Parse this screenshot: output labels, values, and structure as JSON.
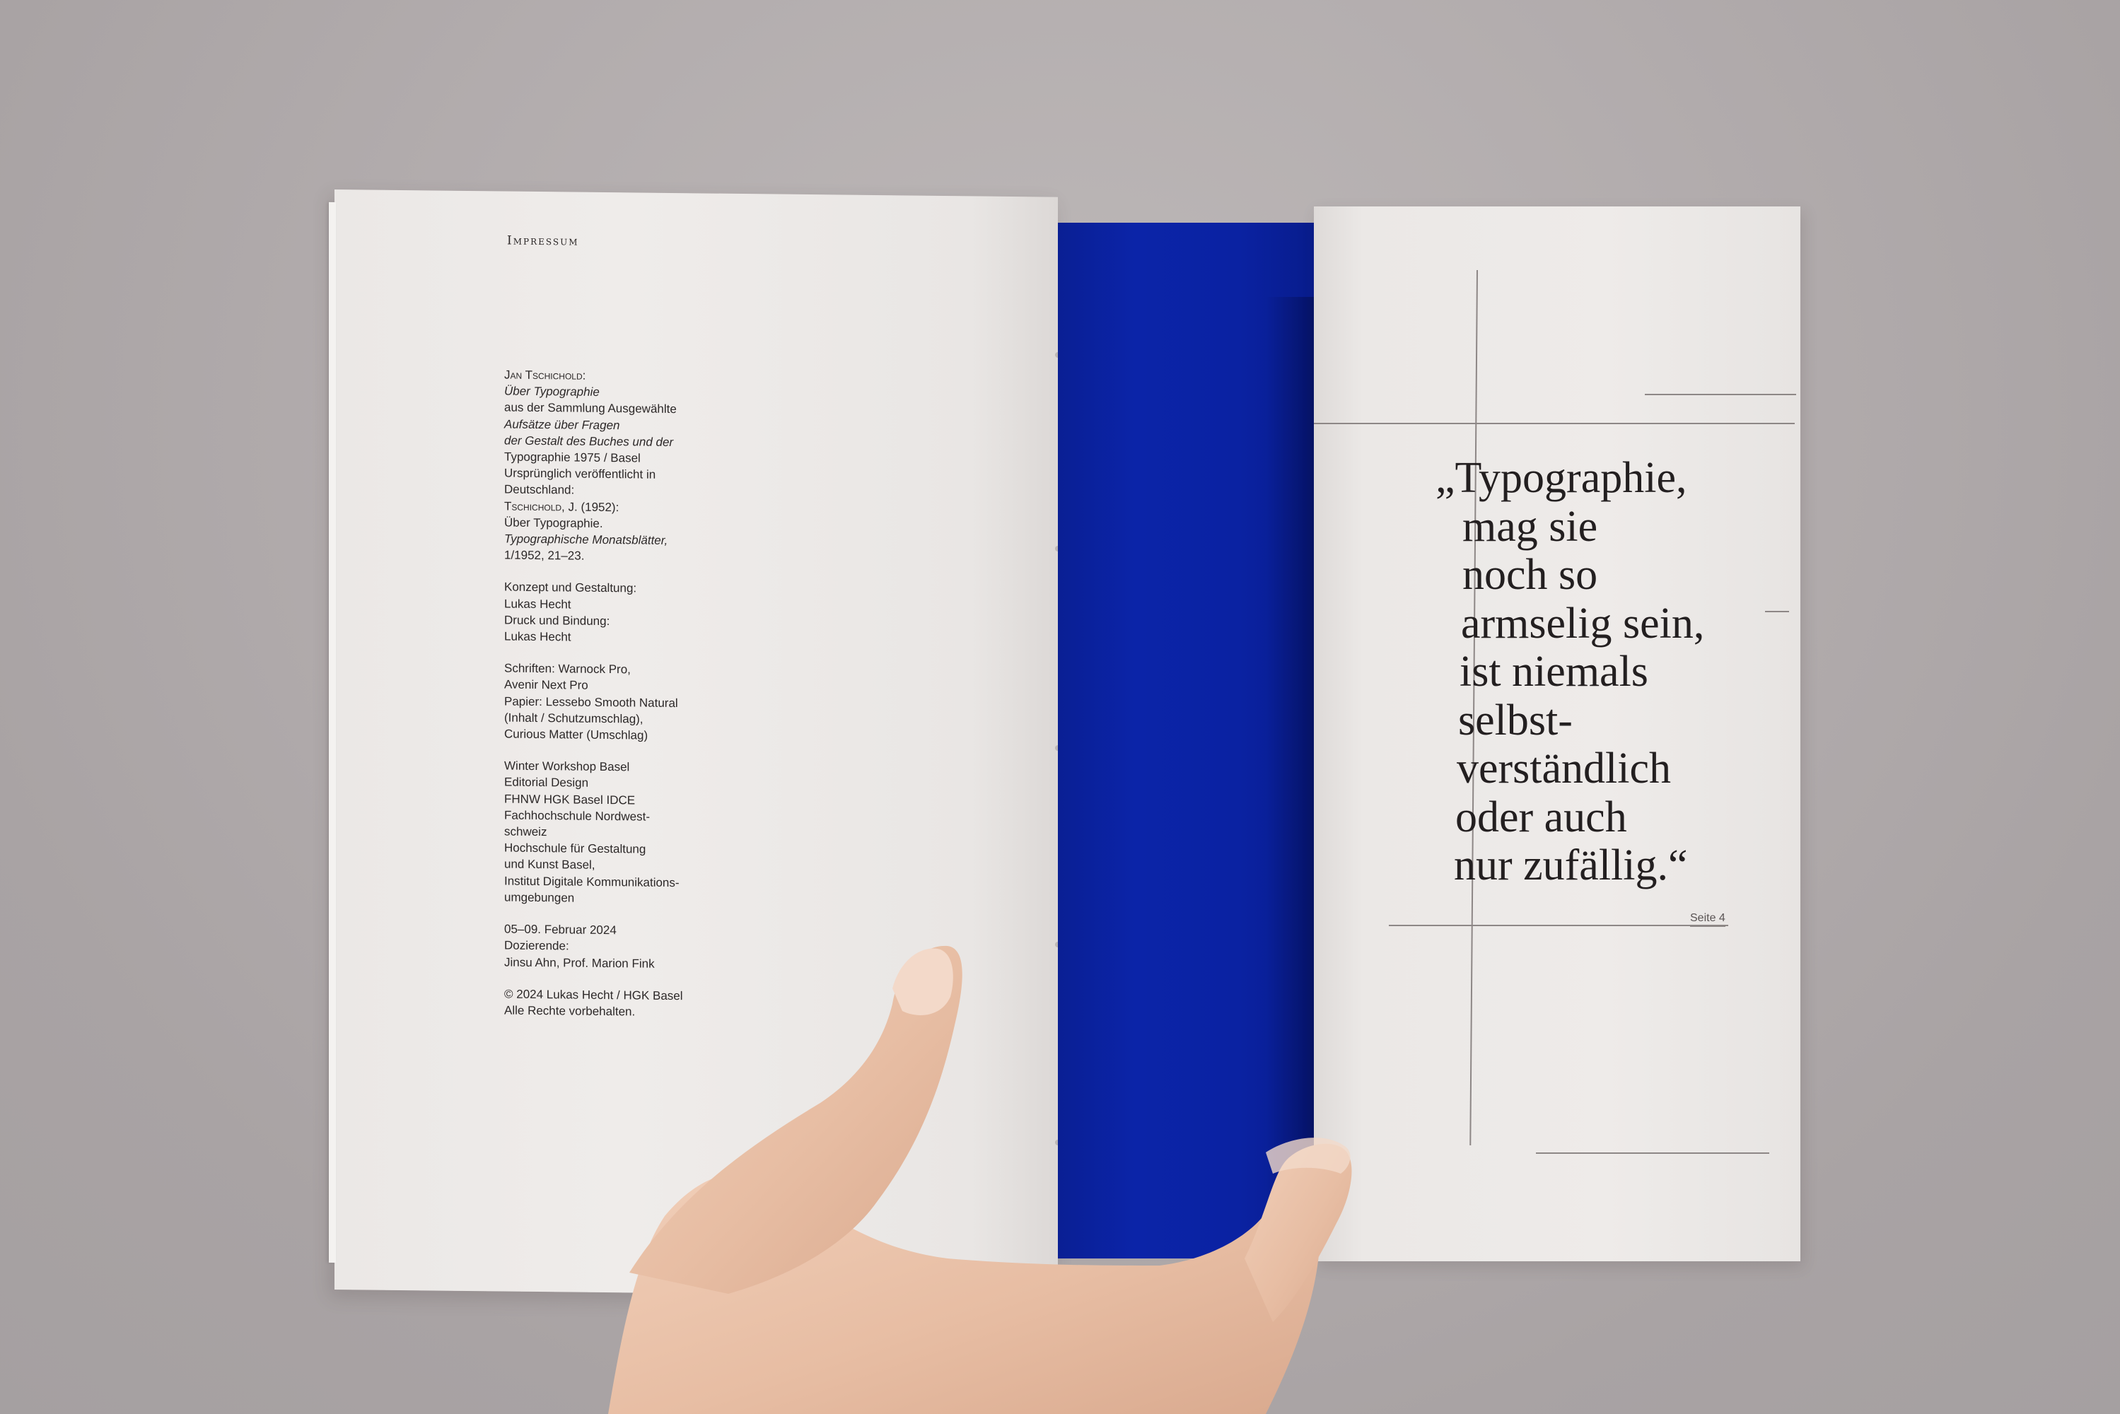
{
  "left_page": {
    "heading": "Impressum",
    "colophon": [
      {
        "lines": [
          {
            "text": "Jan Tschichold:",
            "style": "sc"
          },
          {
            "text": "Über Typographie",
            "style": "it"
          },
          {
            "text": "aus der Sammlung Ausgewählte",
            "style": ""
          },
          {
            "text": "Aufsätze über Fragen",
            "style": "it"
          },
          {
            "text": "der Gestalt des Buches und der",
            "style": "it"
          },
          {
            "text": "Typographie 1975 / Basel",
            "style": ""
          },
          {
            "text": "Ursprünglich veröffentlicht in",
            "style": ""
          },
          {
            "text": "Deutschland:",
            "style": ""
          },
          {
            "text": "Tschichold, J. (1952):",
            "style": "sc"
          },
          {
            "text": "Über Typographie.",
            "style": ""
          },
          {
            "text": "Typographische Monatsblätter,",
            "style": "it"
          },
          {
            "text": "1/1952, 21–23.",
            "style": ""
          }
        ]
      },
      {
        "lines": [
          {
            "text": "Konzept und Gestaltung:",
            "style": ""
          },
          {
            "text": "Lukas Hecht",
            "style": ""
          },
          {
            "text": "Druck und Bindung:",
            "style": ""
          },
          {
            "text": "Lukas Hecht",
            "style": ""
          }
        ]
      },
      {
        "lines": [
          {
            "text": "Schriften: Warnock Pro,",
            "style": ""
          },
          {
            "text": "Avenir Next Pro",
            "style": ""
          },
          {
            "text": "Papier: Lessebo Smooth Natural",
            "style": ""
          },
          {
            "text": "(Inhalt / Schutzumschlag),",
            "style": ""
          },
          {
            "text": "Curious Matter (Umschlag)",
            "style": ""
          }
        ]
      },
      {
        "lines": [
          {
            "text": "Winter Workshop Basel",
            "style": ""
          },
          {
            "text": "Editorial Design",
            "style": ""
          },
          {
            "text": "FHNW HGK Basel IDCE",
            "style": ""
          },
          {
            "text": "Fachhochschule Nordwest-",
            "style": ""
          },
          {
            "text": "schweiz",
            "style": ""
          },
          {
            "text": "Hochschule für Gestaltung",
            "style": ""
          },
          {
            "text": "und Kunst Basel,",
            "style": ""
          },
          {
            "text": "Institut Digitale Kommunikations-",
            "style": ""
          },
          {
            "text": "umgebungen",
            "style": ""
          }
        ]
      },
      {
        "lines": [
          {
            "text": "05–09. Februar 2024",
            "style": ""
          },
          {
            "text": "Dozierende:",
            "style": ""
          },
          {
            "text": "Jinsu Ahn, Prof. Marion Fink",
            "style": ""
          }
        ]
      },
      {
        "lines": [
          {
            "text": "© 2024 Lukas Hecht / HGK Basel",
            "style": ""
          },
          {
            "text": "Alle Rechte vorbehalten.",
            "style": ""
          }
        ]
      }
    ]
  },
  "right_page": {
    "quote_lines": [
      "„Typographie,",
      "mag sie",
      "noch so",
      "armselig sein,",
      "ist niemals",
      "selbst-",
      "verständlich",
      "oder auch",
      "nur zufällig.“"
    ],
    "page_ref": "Seite 4"
  },
  "colors": {
    "background": "#b2acad",
    "paper": "#eeebe9",
    "blue_flap": "#0b24a8",
    "ink": "#231f20",
    "skin": "#e9c1a8"
  }
}
